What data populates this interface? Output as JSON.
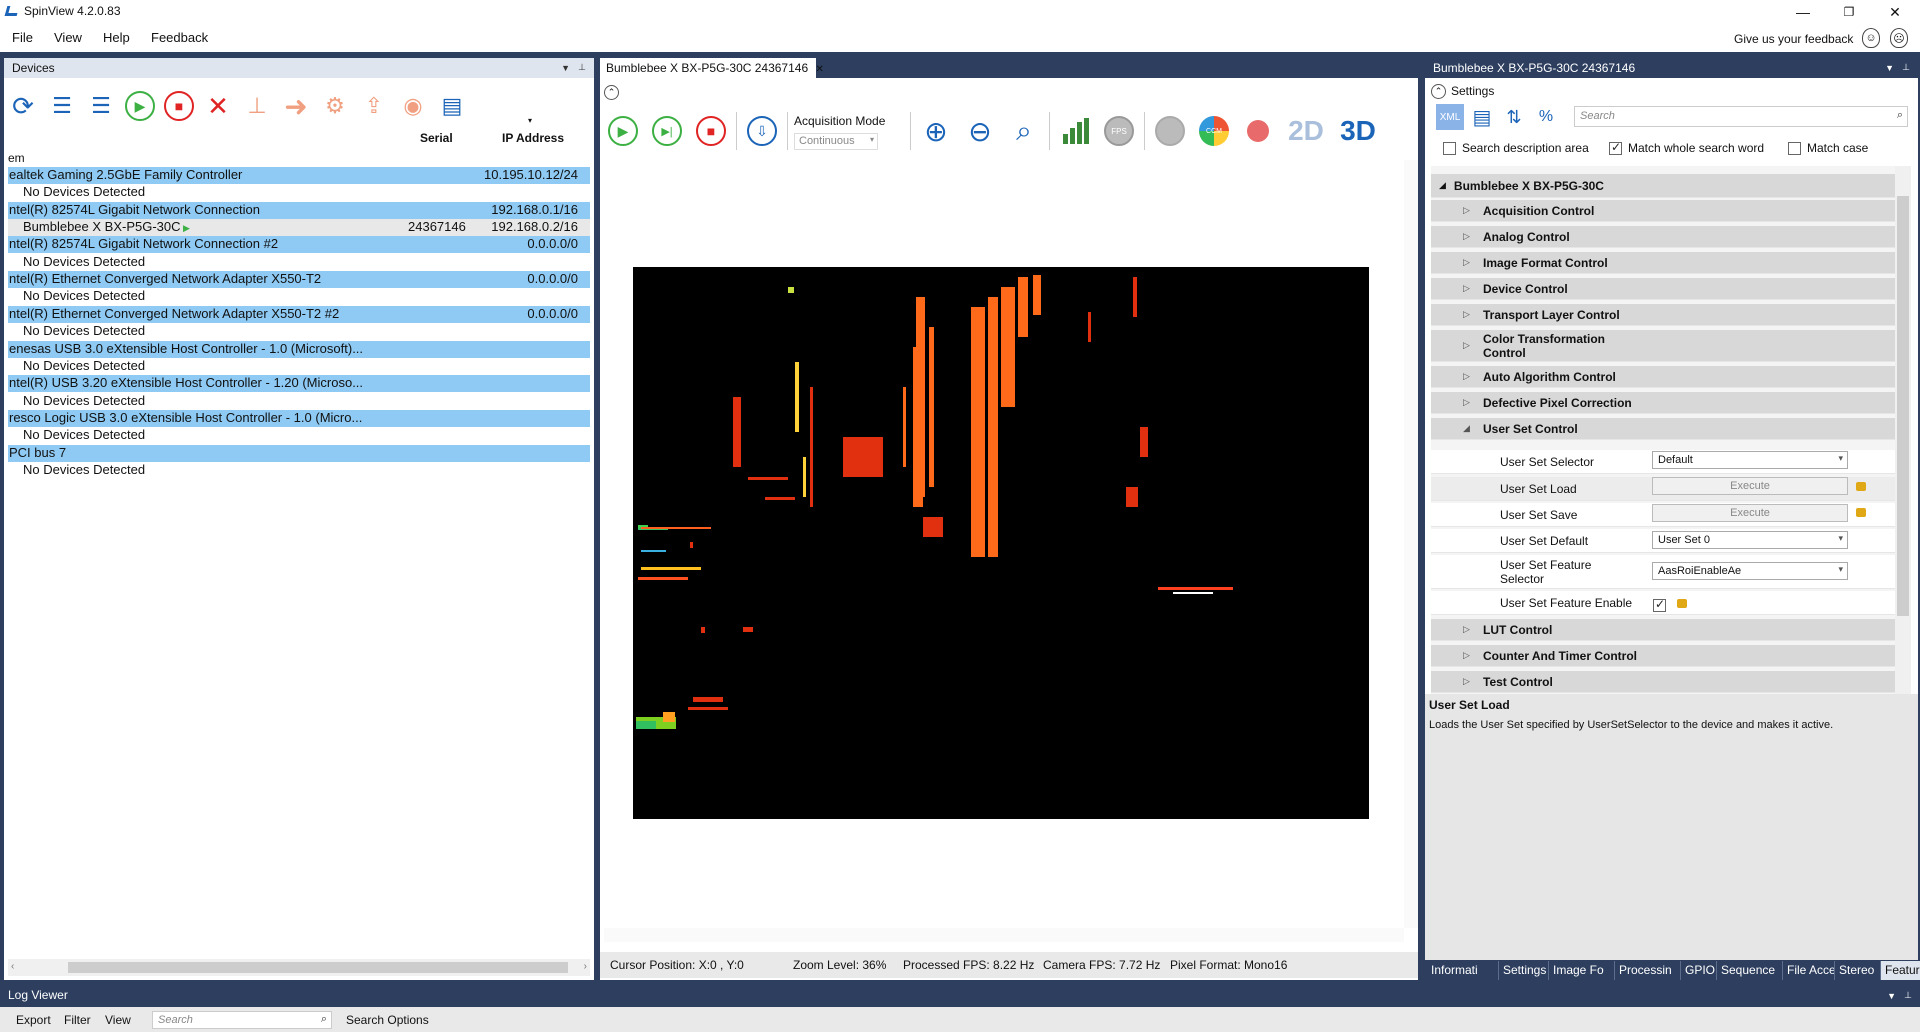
{
  "app": {
    "title": "SpinView 4.2.0.83"
  },
  "window_controls": {
    "minimize": "—",
    "restore": "❐",
    "close": "✕"
  },
  "menu": {
    "items": [
      "File",
      "View",
      "Help",
      "Feedback"
    ],
    "feedback_text": "Give us your feedback"
  },
  "devices_panel": {
    "title": "Devices",
    "columns": {
      "serial": "Serial",
      "ip": "IP Address"
    },
    "root_label": "em",
    "rows": [
      {
        "label": "ealtek Gaming 2.5GbE Family Controller",
        "ip": "10.195.10.12/24",
        "type": "iface"
      },
      {
        "label": "No Devices Detected",
        "type": "child"
      },
      {
        "label": "ntel(R) 82574L Gigabit Network Connection",
        "ip": "192.168.0.1/16",
        "type": "iface"
      },
      {
        "label": "Bumblebee X BX-P5G-30C",
        "serial": "24367146",
        "ip": "192.168.0.2/16",
        "type": "device"
      },
      {
        "label": "ntel(R) 82574L Gigabit Network Connection #2",
        "ip": "0.0.0.0/0",
        "type": "iface"
      },
      {
        "label": "No Devices Detected",
        "type": "child"
      },
      {
        "label": "ntel(R) Ethernet Converged Network Adapter X550-T2",
        "ip": "0.0.0.0/0",
        "type": "iface"
      },
      {
        "label": "No Devices Detected",
        "type": "child"
      },
      {
        "label": "ntel(R) Ethernet Converged Network Adapter X550-T2 #2",
        "ip": "0.0.0.0/0",
        "type": "iface"
      },
      {
        "label": "No Devices Detected",
        "type": "child"
      },
      {
        "label": "enesas USB 3.0 eXtensible Host Controller - 1.0 (Microsoft)...",
        "type": "iface"
      },
      {
        "label": "No Devices Detected",
        "type": "child"
      },
      {
        "label": "ntel(R) USB 3.20 eXtensible Host Controller - 1.20 (Microso...",
        "type": "iface"
      },
      {
        "label": "No Devices Detected",
        "type": "child"
      },
      {
        "label": "resco Logic USB 3.0 eXtensible Host Controller - 1.0 (Micro...",
        "type": "iface"
      },
      {
        "label": "No Devices Detected",
        "type": "child"
      },
      {
        "label": "PCI bus 7",
        "type": "iface"
      },
      {
        "label": "No Devices Detected",
        "type": "child"
      }
    ]
  },
  "stream_panel": {
    "tab_title": "Bumblebee X BX-P5G-30C 24367146",
    "tab_close": "✕",
    "acq_mode_label": "Acquisition Mode",
    "acq_mode_value": "Continuous",
    "mode_2d": "2D",
    "mode_3d": "3D",
    "fps_icon_text": "FPS",
    "ccm_icon_text": "CCM",
    "status": {
      "cursor": "Cursor Position: X:0 , Y:0",
      "zoom": "Zoom Level: 36%",
      "processed_fps": "Processed FPS: 8.22 Hz",
      "camera_fps": "Camera FPS: 7.72 Hz",
      "pixel_format": "Pixel Format: Mono16"
    }
  },
  "features_panel": {
    "title": "Bumblebee X BX-P5G-30C 24367146",
    "settings_label": "Settings",
    "xml_label": "XML",
    "search_placeholder": "Search",
    "opt_search_desc": "Search description area",
    "opt_match_whole": "Match whole search word",
    "opt_match_case": "Match case",
    "root": "Bumblebee X BX-P5G-30C",
    "categories_top": [
      "Acquisition Control",
      "Analog Control",
      "Image Format Control",
      "Device Control",
      "Transport Layer Control",
      "Color Transformation Control",
      "Auto Algorithm Control",
      "Defective Pixel Correction",
      "User Set Control"
    ],
    "user_set": {
      "selector_label": "User Set Selector",
      "selector_value": "Default",
      "load_label": "User Set Load",
      "save_label": "User Set Save",
      "execute": "Execute",
      "default_label": "User Set Default",
      "default_value": "User Set 0",
      "feature_selector_label": "User Set Feature Selector",
      "feature_selector_value": "AasRoiEnableAe",
      "feature_enable_label": "User Set Feature Enable"
    },
    "categories_bottom": [
      "LUT Control",
      "Counter And Timer Control",
      "Test Control"
    ],
    "desc_title": "User Set Load",
    "desc_text": "Loads the User Set specified by UserSetSelector to the device and makes it active.",
    "tabs": [
      "Informati",
      "Settings",
      "Image Fo",
      "Processin",
      "GPIO",
      "Sequence",
      "File Acce:",
      "Stereo",
      "Features"
    ]
  },
  "log_viewer": {
    "title": "Log Viewer",
    "menu": [
      "Export",
      "Filter",
      "View"
    ],
    "search_placeholder": "Search",
    "search_options": "Search Options"
  },
  "colors": {
    "dock": "#2d3e5f",
    "iface_row": "#8ecaf4",
    "accent_blue": "#1b64b8",
    "stop_red": "#e02424",
    "play_green": "#3cb043"
  }
}
